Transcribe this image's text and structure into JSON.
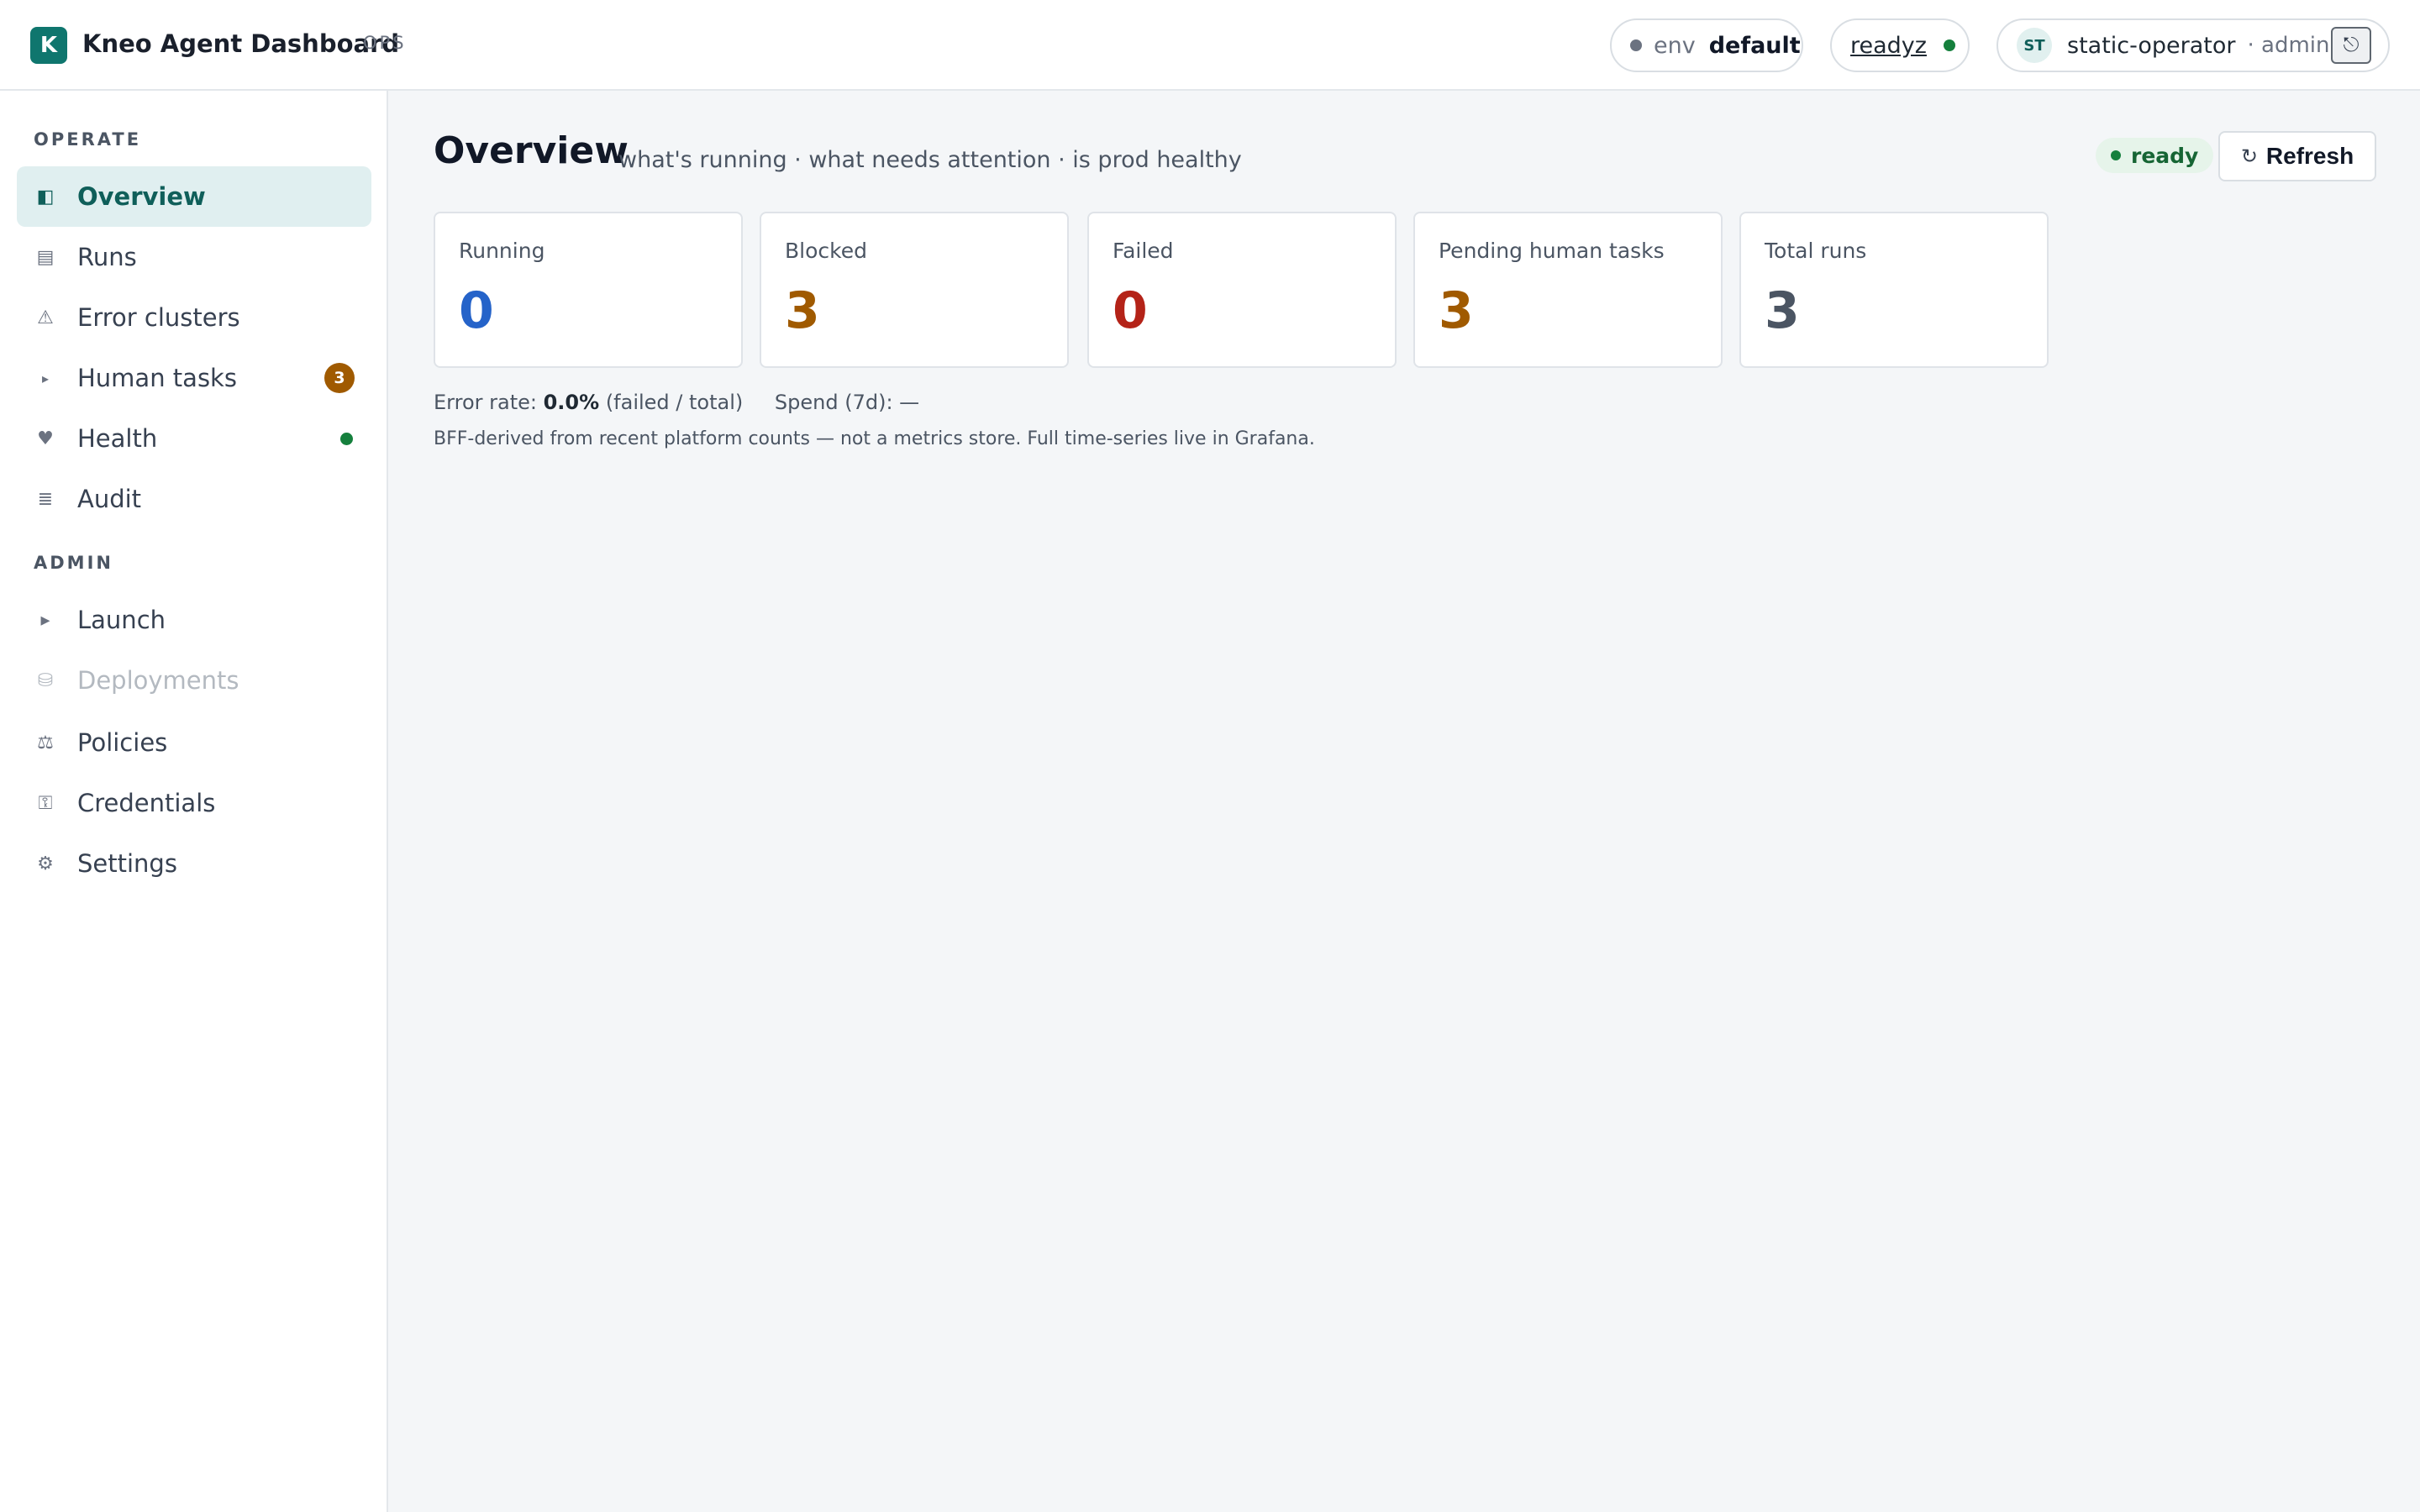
{
  "app": {
    "logo_letter": "K",
    "title": "Kneo Agent Dashboard",
    "tag": "OPS"
  },
  "topbar": {
    "env_key": "env",
    "env_value": "default",
    "readyz_label": "readyz",
    "user_initials": "ST",
    "user_name": "static-operator",
    "user_role": "· admin",
    "logout_icon": "⎋"
  },
  "sidebar": {
    "operate_label": "OPERATE",
    "admin_label": "ADMIN",
    "items": [
      {
        "icon": "◧",
        "icon_name": "overview-icon",
        "label": "Overview"
      },
      {
        "icon": "▤",
        "icon_name": "runs-icon",
        "label": "Runs"
      },
      {
        "icon": "⚠",
        "icon_name": "warning-icon",
        "label": "Error clusters"
      },
      {
        "icon": "▸",
        "icon_name": "caret-right-icon",
        "label": "Human tasks",
        "badge": "3"
      },
      {
        "icon": "♥",
        "icon_name": "heart-icon",
        "label": "Health"
      },
      {
        "icon": "≣",
        "icon_name": "audit-icon",
        "label": "Audit"
      },
      {
        "icon": "▸",
        "icon_name": "play-icon",
        "label": "Launch"
      },
      {
        "icon": "⛁",
        "icon_name": "database-icon",
        "label": "Deployments",
        "disabled": true
      },
      {
        "icon": "⚖",
        "icon_name": "scales-icon",
        "label": "Policies"
      },
      {
        "icon": "⚿",
        "icon_name": "key-icon",
        "label": "Credentials"
      },
      {
        "icon": "⚙",
        "icon_name": "gear-icon",
        "label": "Settings"
      }
    ]
  },
  "main": {
    "title": "Overview",
    "subtitle": "what's running · what needs attention · is prod healthy",
    "status": "ready",
    "refresh_icon": "↻",
    "refresh_label": "Refresh",
    "stats": [
      {
        "label": "Running",
        "value": "0",
        "color": "#2563c9"
      },
      {
        "label": "Blocked",
        "value": "3",
        "color": "#a05a00"
      },
      {
        "label": "Failed",
        "value": "0",
        "color": "#b42318"
      },
      {
        "label": "Pending human tasks",
        "value": "3",
        "color": "#a05a00"
      },
      {
        "label": "Total runs",
        "value": "3",
        "color": "#4b5563"
      }
    ],
    "error_rate_label": "Error rate:",
    "error_rate_value": "0.0%",
    "error_rate_note": "(failed / total)",
    "spend": "Spend (7d): —",
    "footnote": "BFF-derived from recent platform counts — not a metrics store. Full time-series live in Grafana."
  }
}
